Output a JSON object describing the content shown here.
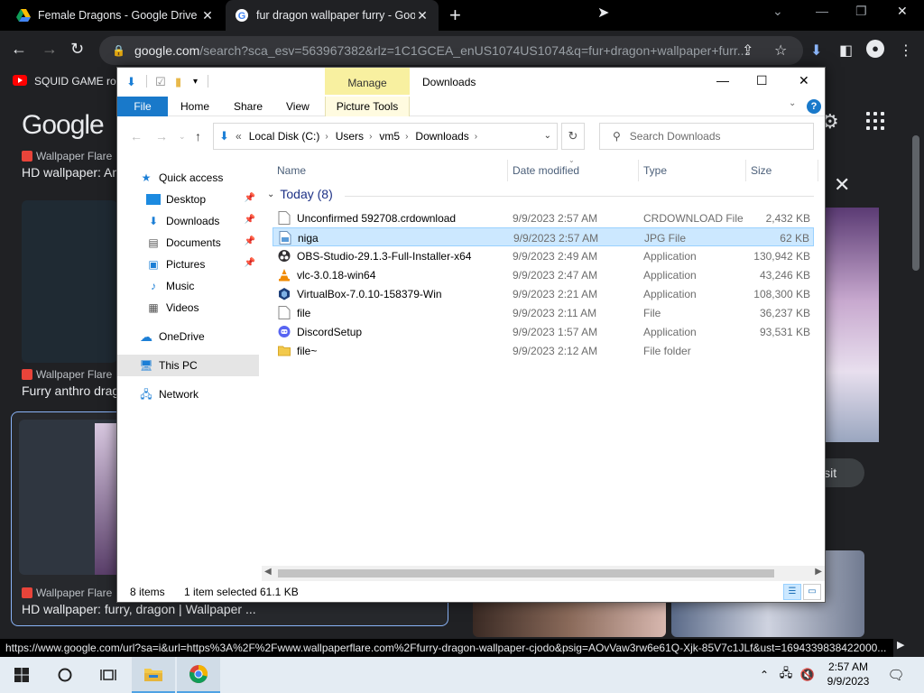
{
  "browser": {
    "tabs": [
      {
        "title": "Female Dragons - Google Drive",
        "icon": "google-drive-icon"
      },
      {
        "title": "fur dragon wallpaper furry - Goo",
        "icon": "google-icon"
      }
    ],
    "address": {
      "domain": "google.com",
      "path": "/search?sca_esv=563967382&rlz=1C1GCEA_enUS1074US1074&q=fur+dragon+wallpaper+furr..."
    },
    "bookmark": "SQUID GAME rob",
    "status_url": "https://www.google.com/url?sa=i&url=https%3A%2F%2Fwww.wallpaperflare.com%2Ffurry-dragon-wallpaper-cjodo&psig=AOvVaw3rw6e61Q-Xjk-85V7c1JLf&ust=1694339838422000..."
  },
  "google": {
    "logo": "Google",
    "results": [
      {
        "source": "Wallpaper Flare",
        "title": "HD wallpaper: An"
      },
      {
        "source": "Wallpaper Flare",
        "title": "Furry anthro drag"
      },
      {
        "source": "Wallpaper Flare",
        "title": "HD wallpaper: furry, dragon | Wallpaper ..."
      }
    ],
    "visit_label": "isit"
  },
  "explorer": {
    "title": "Downloads",
    "manage_tab": "Manage",
    "ribbon_tabs": [
      "File",
      "Home",
      "Share",
      "View",
      "Picture Tools"
    ],
    "breadcrumbs": [
      "Local Disk (C:)",
      "Users",
      "vm5",
      "Downloads"
    ],
    "search_placeholder": "Search Downloads",
    "nav": [
      {
        "label": "Quick access",
        "icon": "star-icon",
        "pinned": false
      },
      {
        "label": "Desktop",
        "icon": "desktop-icon",
        "pinned": true
      },
      {
        "label": "Downloads",
        "icon": "download-icon",
        "pinned": true
      },
      {
        "label": "Documents",
        "icon": "documents-icon",
        "pinned": true
      },
      {
        "label": "Pictures",
        "icon": "pictures-icon",
        "pinned": true
      },
      {
        "label": "Music",
        "icon": "music-icon",
        "pinned": false
      },
      {
        "label": "Videos",
        "icon": "videos-icon",
        "pinned": false
      },
      {
        "label": "OneDrive",
        "icon": "cloud-icon",
        "pinned": false
      },
      {
        "label": "This PC",
        "icon": "computer-icon",
        "pinned": false
      },
      {
        "label": "Network",
        "icon": "network-icon",
        "pinned": false
      }
    ],
    "columns": [
      "Name",
      "Date modified",
      "Type",
      "Size"
    ],
    "group": "Today (8)",
    "files": [
      {
        "name": "Unconfirmed 592708.crdownload",
        "date": "9/9/2023 2:57 AM",
        "type": "CRDOWNLOAD File",
        "size": "2,432 KB",
        "icon": "blank-file-icon"
      },
      {
        "name": "niga",
        "date": "9/9/2023 2:57 AM",
        "type": "JPG File",
        "size": "62 KB",
        "icon": "image-file-icon"
      },
      {
        "name": "OBS-Studio-29.1.3-Full-Installer-x64",
        "date": "9/9/2023 2:49 AM",
        "type": "Application",
        "size": "130,942 KB",
        "icon": "obs-icon"
      },
      {
        "name": "vlc-3.0.18-win64",
        "date": "9/9/2023 2:47 AM",
        "type": "Application",
        "size": "43,246 KB",
        "icon": "vlc-icon"
      },
      {
        "name": "VirtualBox-7.0.10-158379-Win",
        "date": "9/9/2023 2:21 AM",
        "type": "Application",
        "size": "108,300 KB",
        "icon": "virtualbox-icon"
      },
      {
        "name": "file",
        "date": "9/9/2023 2:11 AM",
        "type": "File",
        "size": "36,237 KB",
        "icon": "blank-file-icon"
      },
      {
        "name": "DiscordSetup",
        "date": "9/9/2023 1:57 AM",
        "type": "Application",
        "size": "93,531 KB",
        "icon": "discord-icon"
      },
      {
        "name": "file~",
        "date": "9/9/2023 2:12 AM",
        "type": "File folder",
        "size": "",
        "icon": "folder-icon"
      }
    ],
    "status": {
      "count": "8 items",
      "selection": "1 item selected",
      "selection_size": "61.1 KB"
    }
  },
  "taskbar": {
    "time": "2:57 AM",
    "date": "9/9/2023"
  },
  "colors": {
    "accent": "#1979ca",
    "selection": "#cce8ff",
    "chrome_bg": "#202124"
  }
}
